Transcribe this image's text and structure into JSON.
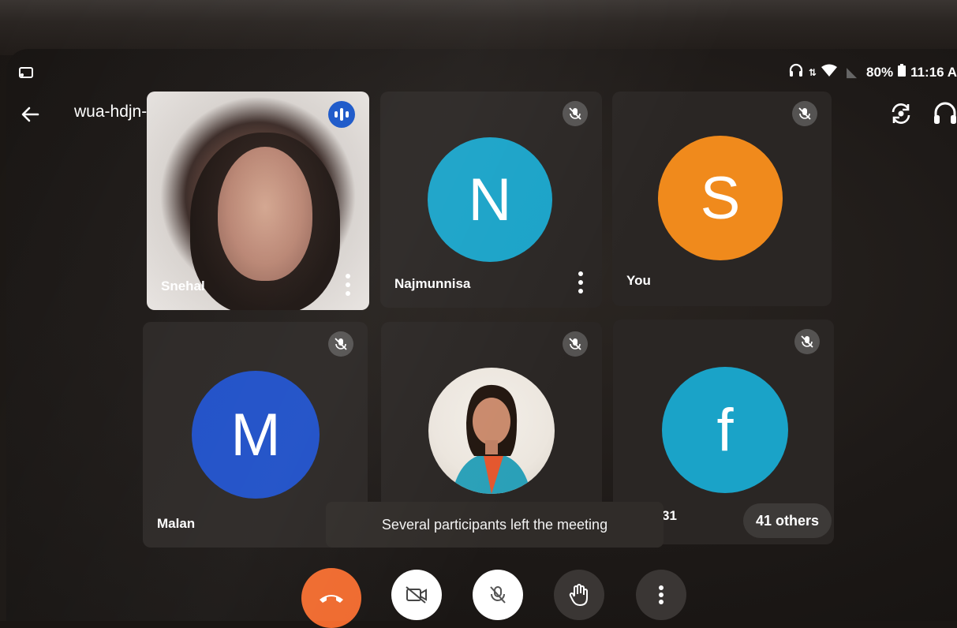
{
  "status_bar": {
    "battery": "80%",
    "time": "11:16 A"
  },
  "topbar": {
    "meeting_code": "wua-hdjn-muh",
    "caret": "▶"
  },
  "tiles": [
    {
      "name": "Snehal",
      "type": "video",
      "active_speaker": true
    },
    {
      "name": "Najmunnisa",
      "initial": "N",
      "avatar_color": "#1aa3c8",
      "muted": true
    },
    {
      "name": "You",
      "initial": "S",
      "avatar_color": "#f08a1c",
      "muted": true
    },
    {
      "name": "Malan",
      "initial": "M",
      "avatar_color": "#1e4fc7",
      "muted": true
    },
    {
      "name": "",
      "type": "photo",
      "muted": true
    },
    {
      "name": "31",
      "initial": "f",
      "avatar_color": "#1aa3c8",
      "muted": true
    }
  ],
  "toast": "Several participants left the meeting",
  "others": "41 others",
  "controls": {
    "end_call_color": "#ef6a2e",
    "button_bg": "#ffffff",
    "dark_bg": "#3a3634"
  },
  "icons": [
    "cast-icon",
    "back-arrow-icon",
    "switch-camera-icon",
    "headphones-icon",
    "mic-off-icon",
    "more-vert-icon",
    "end-call-icon",
    "video-off-icon",
    "raise-hand-icon",
    "wifi-icon",
    "battery-icon"
  ]
}
